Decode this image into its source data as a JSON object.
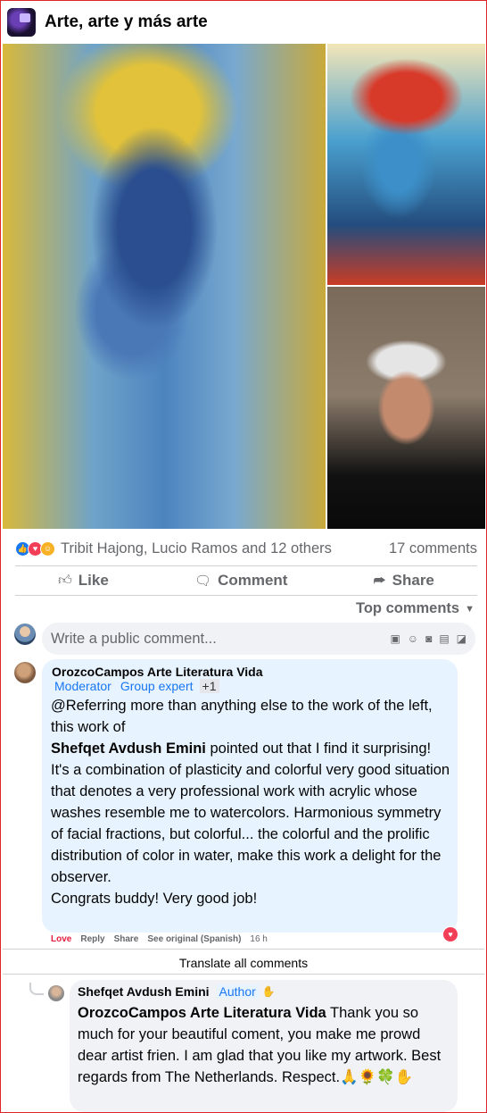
{
  "group": {
    "title": "Arte, arte y más arte"
  },
  "photos": {
    "main_alt": "Expressionist portrait painting",
    "top_right_alt": "Portrait painting with red headscarf",
    "bottom_right_alt": "Photo of man in white cap"
  },
  "reactions": {
    "icons": [
      "like-icon",
      "love-icon",
      "care-icon"
    ],
    "summary": "Tribit Hajong, Lucio Ramos and 12 others",
    "comments_count": "17 comments"
  },
  "actions": {
    "like": "Like",
    "comment": "Comment",
    "share": "Share"
  },
  "sort": {
    "label": "Top comments"
  },
  "write": {
    "placeholder": "Write a public comment..."
  },
  "comment1": {
    "author": "OrozcoCampos Arte Literatura Vida",
    "badges": [
      "Moderator",
      "Group expert"
    ],
    "badge_extra": "+1",
    "text_intro": "@Referring more than anything else to the work of the left, this work of",
    "mention": "Shefqet Avdush Emini",
    "text_after_mention": " pointed out that I find it surprising!",
    "text_body": "It's a combination of plasticity and colorful very good situation that denotes a very professional work with acrylic whose washes resemble me to watercolors. Harmonious symmetry of facial fractions, but colorful... the colorful and the prolific distribution of color in water, make this work a delight for the observer.",
    "text_end": "Congrats buddy! Very good job!",
    "meta": {
      "love": "Love",
      "reply": "Reply",
      "share": "Share",
      "see_original": "See original (Spanish)",
      "time": "16 h"
    }
  },
  "translate_all": "Translate all comments",
  "reply1": {
    "author": "Shefqet Avdush Emini",
    "badge": "Author",
    "mention": "OrozcoCampos Arte Literatura Vida",
    "text": " Thank you so much for your beautiful coment, you make me prowd dear artist frien. I am glad that you like my artwork. Best regards from The Netherlands. Respect.🙏🌻🍀✋"
  },
  "colors": {
    "accent": "#1877f2",
    "love": "#f33e58",
    "frame": "#e1242a"
  }
}
